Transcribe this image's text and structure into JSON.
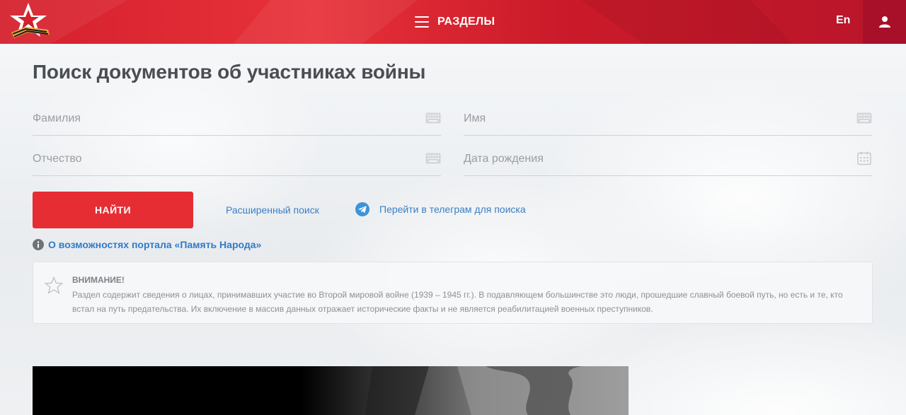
{
  "header": {
    "menu_label": "РАЗДЕЛЫ",
    "lang_label": "En",
    "brand_color": "#d4202d"
  },
  "page": {
    "title": "Поиск документов об участниках войны"
  },
  "form": {
    "last_name_placeholder": "Фамилия",
    "first_name_placeholder": "Имя",
    "patronymic_placeholder": "Отчество",
    "birth_date_placeholder": "Дата рождения",
    "search_button": "НАЙТИ",
    "advanced_search": "Расширенный поиск",
    "telegram_search": "Перейти в телеграм для поиска"
  },
  "about": {
    "text": "О возможностях портала «Память Народа»"
  },
  "notice": {
    "title": "ВНИМАНИЕ!",
    "text": "Раздел содержит сведения о лицах, принимавших участие во Второй мировой войне (1939 – 1945 гг.). В подавляющем большинстве это люди, прошедшие славный боевой путь, но есть и те, кто встал на путь предательства. Их включение в массив данных отражает исторические факты и не является реабилитацией военных преступников."
  },
  "icons": {
    "menu": "hamburger-icon",
    "user": "user-icon",
    "keyboard": "keyboard-icon",
    "calendar": "calendar-icon",
    "telegram": "telegram-icon",
    "info": "info-icon",
    "star": "star-icon"
  },
  "colors": {
    "accent": "#e62d34",
    "link": "#3b7fc4",
    "user_button": "#a8102a"
  }
}
